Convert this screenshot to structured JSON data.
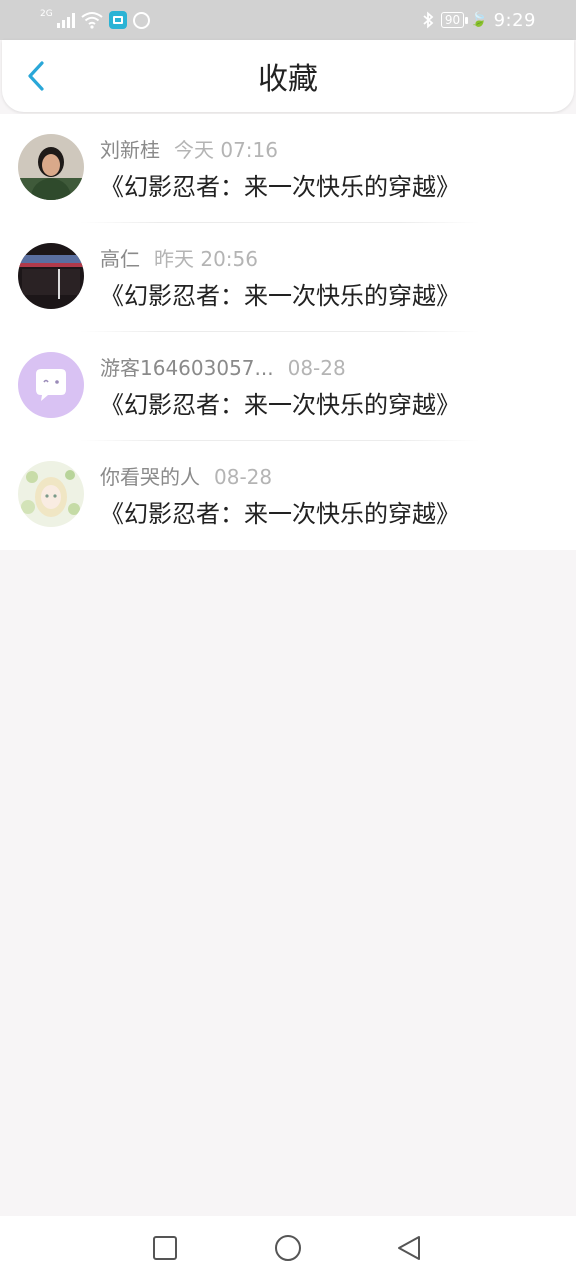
{
  "status_bar": {
    "signal_label": "2G",
    "battery": "90",
    "time": "9:29"
  },
  "header": {
    "title": "收藏"
  },
  "favorites": [
    {
      "name": "刘新桂",
      "time": "今天 07:16",
      "book": "《幻影忍者：来一次快乐的穿越》"
    },
    {
      "name": "高仁",
      "time": "昨天 20:56",
      "book": "《幻影忍者：来一次快乐的穿越》"
    },
    {
      "name": "游客164603057...",
      "time": "08-28",
      "book": "《幻影忍者：来一次快乐的穿越》"
    },
    {
      "name": "你看哭的人",
      "time": "08-28",
      "book": "《幻影忍者：来一次快乐的穿越》"
    }
  ],
  "colors": {
    "accent": "#2aa7d8",
    "status_bar": "#d2d2d2",
    "page_background": "#f7f5f6",
    "guest_avatar": "#d9c2f3"
  }
}
